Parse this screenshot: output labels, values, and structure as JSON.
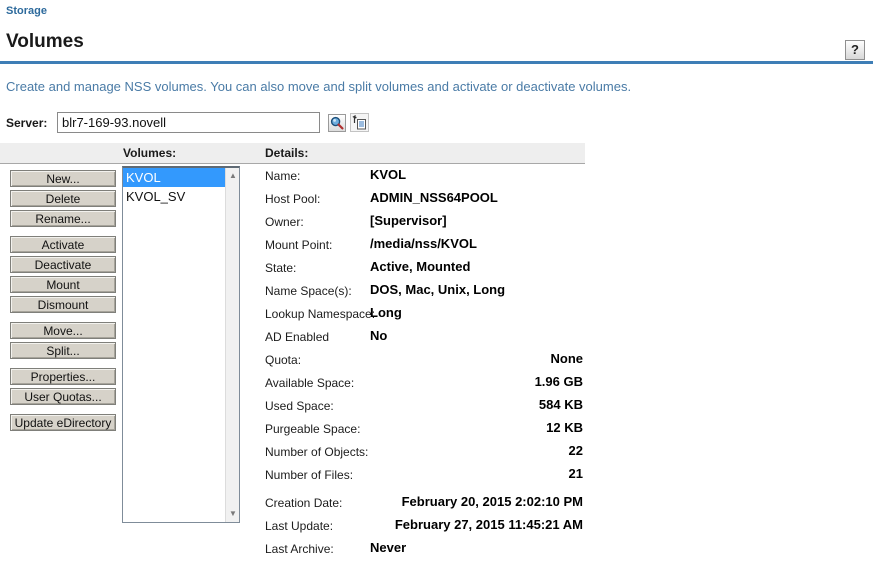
{
  "colors": {
    "accent_rule": "#3e7eb6",
    "selection_blue": "#3399fd",
    "link_blue": "#2d6a9c",
    "description_blue": "#4a7ba6"
  },
  "breadcrumb": {
    "label": "Storage"
  },
  "page": {
    "title": "Volumes",
    "help_label": "?",
    "description": "Create and manage NSS volumes. You can also move and split volumes and activate or deactivate volumes."
  },
  "server": {
    "label": "Server:",
    "value": "blr7-169-93.novell",
    "browse_icon": "magnifier-icon",
    "history_icon": "object-history-icon"
  },
  "panel": {
    "volumes_header": "Volumes:",
    "details_header": "Details:"
  },
  "actions": {
    "groups": [
      {
        "items": [
          {
            "name": "new-button",
            "label": "New..."
          },
          {
            "name": "delete-button",
            "label": "Delete"
          },
          {
            "name": "rename-button",
            "label": "Rename..."
          }
        ]
      },
      {
        "items": [
          {
            "name": "activate-button",
            "label": "Activate"
          },
          {
            "name": "deactivate-button",
            "label": "Deactivate"
          },
          {
            "name": "mount-button",
            "label": "Mount"
          },
          {
            "name": "dismount-button",
            "label": "Dismount"
          }
        ]
      },
      {
        "items": [
          {
            "name": "move-button",
            "label": "Move..."
          },
          {
            "name": "split-button",
            "label": "Split..."
          }
        ]
      },
      {
        "items": [
          {
            "name": "properties-button",
            "label": "Properties..."
          },
          {
            "name": "user-quotas-button",
            "label": "User Quotas..."
          }
        ]
      },
      {
        "items": [
          {
            "name": "update-edirectory-button",
            "label": "Update eDirectory"
          }
        ]
      }
    ]
  },
  "volumes": {
    "scroll_up_glyph": "▲",
    "scroll_down_glyph": "▼",
    "items": [
      {
        "name": "KVOL",
        "selected": true
      },
      {
        "name": "KVOL_SV",
        "selected": false
      }
    ]
  },
  "details": {
    "rows": [
      {
        "label": "Name:",
        "value": "KVOL",
        "align": "left"
      },
      {
        "label": "Host Pool:",
        "value": "ADMIN_NSS64POOL",
        "align": "left"
      },
      {
        "label": "Owner:",
        "value": "[Supervisor]",
        "align": "left"
      },
      {
        "label": "Mount Point:",
        "value": "/media/nss/KVOL",
        "align": "left"
      },
      {
        "label": "State:",
        "value": "Active, Mounted",
        "align": "left"
      },
      {
        "label": "Name Space(s):",
        "value": "DOS, Mac, Unix, Long",
        "align": "left"
      },
      {
        "label": "Lookup Namespace:",
        "value": "Long",
        "align": "left"
      },
      {
        "label": "AD Enabled",
        "value": "No",
        "align": "left"
      },
      {
        "label": "Quota:",
        "value": "None",
        "align": "right"
      },
      {
        "label": "Available Space:",
        "value": "1.96 GB",
        "align": "right"
      },
      {
        "label": "Used Space:",
        "value": "584 KB",
        "align": "right"
      },
      {
        "label": "Purgeable Space:",
        "value": "12 KB",
        "align": "right"
      },
      {
        "label": "Number of Objects:",
        "value": "22",
        "align": "right"
      },
      {
        "label": "Number of Files:",
        "value": "21",
        "align": "right"
      },
      {
        "label": "Creation Date:",
        "value": "February 20, 2015 2:02:10 PM",
        "align": "right",
        "group_break": true
      },
      {
        "label": "Last Update:",
        "value": "February 27, 2015 11:45:21 AM",
        "align": "right"
      },
      {
        "label": "Last Archive:",
        "value": "Never",
        "align": "left"
      }
    ]
  }
}
